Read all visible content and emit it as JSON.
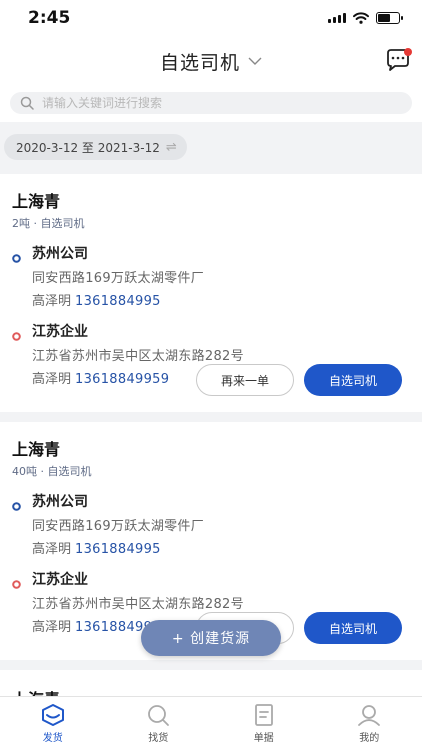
{
  "status": {
    "time": "2:45"
  },
  "nav": {
    "title": "自选司机"
  },
  "search": {
    "placeholder": "请输入关键词进行搜索"
  },
  "date_range": {
    "label": "2020-3-12 至 2021-3-12",
    "swap_glyph": "⇌"
  },
  "orders": [
    {
      "title": "上海青",
      "subtitle": "2吨 · 自选司机",
      "origin": {
        "name": "苏州公司",
        "address": "同安西路169万跃太湖零件厂",
        "contact": "高泽明",
        "phone": "1361884995"
      },
      "destination": {
        "name": "江苏企业",
        "address": "江苏省苏州市吴中区太湖东路282号",
        "contact": "高泽明",
        "phone": "13618849959"
      },
      "reorder_label": "再来一单",
      "choose_driver_label": "自选司机"
    },
    {
      "title": "上海青",
      "subtitle": "40吨 · 自选司机",
      "origin": {
        "name": "苏州公司",
        "address": "同安西路169万跃太湖零件厂",
        "contact": "高泽明",
        "phone": "1361884995"
      },
      "destination": {
        "name": "江苏企业",
        "address": "江苏省苏州市吴中区太湖东路282号",
        "contact": "高泽明",
        "phone": "13618849959"
      },
      "reorder_label": "再来一单",
      "choose_driver_label": "自选司机"
    },
    {
      "title": "上海青"
    }
  ],
  "fab": {
    "label": "+ 创建货源"
  },
  "tabs": [
    {
      "label": "发货",
      "icon": "ship-icon",
      "active": true
    },
    {
      "label": "找货",
      "icon": "search-icon",
      "active": false
    },
    {
      "label": "单据",
      "icon": "document-icon",
      "active": false
    },
    {
      "label": "我的",
      "icon": "user-icon",
      "active": false
    }
  ],
  "colors": {
    "primary": "#1f57c9",
    "origin_dot": "#2753a6",
    "destination_dot": "#e05a5a",
    "badge": "#e53935"
  }
}
